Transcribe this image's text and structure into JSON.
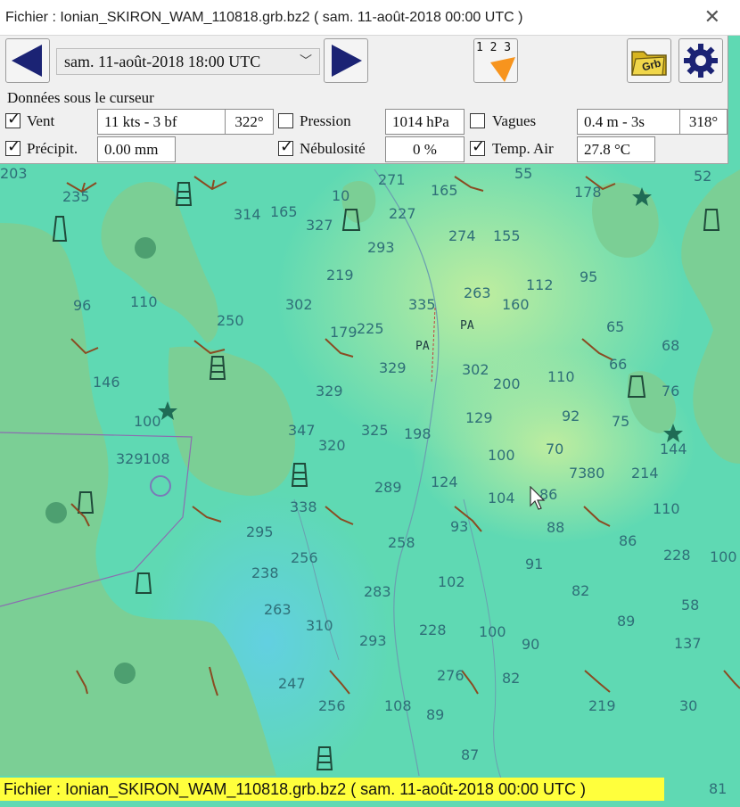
{
  "window": {
    "title": "Fichier : Ionian_SKIRON_WAM_110818.grb.bz2 ( sam. 11-août-2018 00:00  UTC )"
  },
  "toolbar": {
    "date_value": "sam. 11-août-2018 18:00  UTC",
    "buttons": {
      "prev": "arrow-left-icon",
      "next": "arrow-right-icon",
      "numbers": "numbers-123-icon",
      "grib": "grib-folder-icon",
      "settings": "gear-icon"
    },
    "grib_label": "Grb",
    "numbers_label": "1 2 3"
  },
  "cursor_panel": {
    "heading": "Données sous le curseur",
    "vent": {
      "label": "Vent",
      "checked": true,
      "value": "11 kts -  3 bf",
      "direction": "322°"
    },
    "pression": {
      "label": "Pression",
      "checked": false,
      "value": "1014 hPa"
    },
    "vagues": {
      "label": "Vagues",
      "checked": false,
      "value": "0.4 m - 3s",
      "direction": "318°"
    },
    "precip": {
      "label": "Précipit.",
      "checked": true,
      "value": "0.00 mm"
    },
    "nebulosite": {
      "label": "Nébulosité",
      "checked": true,
      "value": "0 %"
    },
    "temp": {
      "label": "Temp. Air",
      "checked": true,
      "value": "27.8 °C"
    }
  },
  "status_bar": {
    "text": "Fichier : Ionian_SKIRON_WAM_110818.grb.bz2 ( sam. 11-août-2018 00:00  UTC )"
  },
  "map": {
    "colors": {
      "sea": "#5fd9b3",
      "land": "#7bd09a",
      "deep": "#6bcfe0",
      "warm": "#bfec9c",
      "arrow": "#8a4b22",
      "depth": "#2f6f78"
    },
    "labels": [
      "PA",
      "PA"
    ],
    "depths": [
      "203",
      "235",
      "314",
      "165",
      "10",
      "327",
      "271",
      "227",
      "165",
      "274",
      "155",
      "55",
      "178",
      "52",
      "96",
      "110",
      "293",
      "219",
      "302",
      "335",
      "263",
      "160",
      "112",
      "95",
      "250",
      "179",
      "225",
      "329",
      "302",
      "200",
      "110",
      "92",
      "75",
      "146",
      "329",
      "347",
      "325",
      "198",
      "129",
      "100",
      "70",
      "144",
      "100",
      "108",
      "329",
      "320",
      "289",
      "124",
      "104",
      "86",
      "80",
      "214",
      "338",
      "258",
      "93",
      "88",
      "86",
      "228",
      "295",
      "256",
      "102",
      "91",
      "82",
      "89",
      "238",
      "263",
      "283",
      "310",
      "293",
      "228",
      "100",
      "90",
      "58",
      "137",
      "247",
      "256",
      "108",
      "89",
      "82",
      "219",
      "30",
      "87",
      "276",
      "81",
      "65",
      "66",
      "68",
      "76",
      "73",
      "110",
      "100"
    ]
  }
}
